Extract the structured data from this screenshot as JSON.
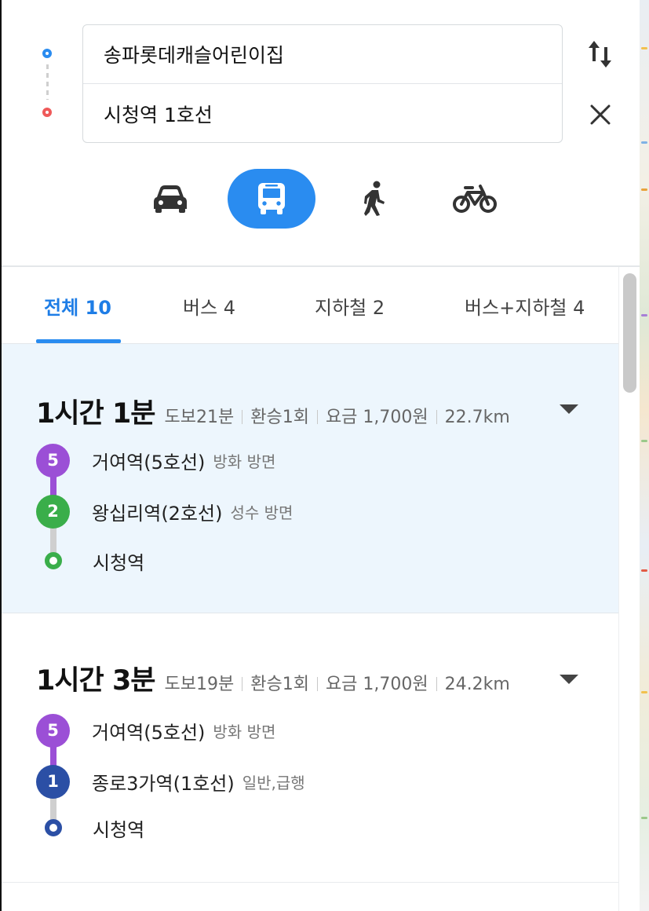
{
  "search": {
    "origin": "송파롯데캐슬어린이집",
    "destination": "시청역 1호선",
    "swap_icon": "swap-vertical-icon",
    "clear_icon": "close-icon"
  },
  "modes": [
    {
      "name": "car",
      "icon": "car-icon",
      "selected": false
    },
    {
      "name": "bus",
      "icon": "bus-icon",
      "selected": true
    },
    {
      "name": "walk",
      "icon": "walk-icon",
      "selected": false
    },
    {
      "name": "bike",
      "icon": "bike-icon",
      "selected": false
    }
  ],
  "tabs": [
    "전체 10",
    "버스 4",
    "지하철 2",
    "버스+지하철 4"
  ],
  "colors": {
    "accent": "#2a8cf0",
    "line5": "#9b4fd6",
    "line2": "#3aae4a",
    "line1": "#2b4fa5",
    "selected_bg": "#edf6fd"
  },
  "routes": [
    {
      "time": "1시간 1분",
      "walk": "도보21분",
      "transfer": "환승1회",
      "fare": "요금 1,700원",
      "distance": "22.7km",
      "steps": [
        {
          "badge": "5",
          "name": "거여역(5호선)",
          "dir": "방화 방면",
          "color": "#9b4fd6"
        },
        {
          "badge": "2",
          "name": "왕십리역(2호선)",
          "dir": "성수 방면",
          "color": "#3aae4a"
        }
      ],
      "end": "시청역"
    },
    {
      "time": "1시간 3분",
      "walk": "도보19분",
      "transfer": "환승1회",
      "fare": "요금 1,700원",
      "distance": "24.2km",
      "steps": [
        {
          "badge": "5",
          "name": "거여역(5호선)",
          "dir": "방화 방면",
          "color": "#9b4fd6"
        },
        {
          "badge": "1",
          "name": "종로3가역(1호선)",
          "dir": "일반,급행",
          "color": "#2b4fa5"
        }
      ],
      "end": "시청역"
    }
  ]
}
